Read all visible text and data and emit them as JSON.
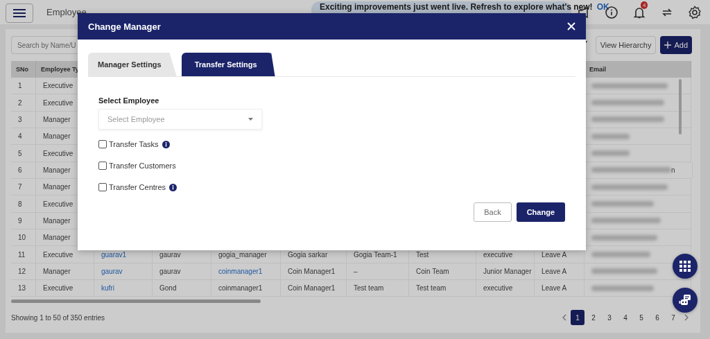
{
  "top_bar": {
    "title": "Employee",
    "banner": {
      "text": "Exciting improvements just went live. Refresh to explore what's new!",
      "action": "OK"
    },
    "notification_count": "4"
  },
  "toolbar": {
    "search": {
      "placeholder": "Search by Name/U"
    },
    "buttons": [
      {
        "label": "View Hierarchy",
        "kind": "outline"
      },
      {
        "label": "Add",
        "kind": "primary"
      }
    ]
  },
  "table": {
    "columns": [
      "SNo",
      "Employee Ty",
      "Email"
    ],
    "rows": [
      {
        "cells": [
          {
            "text": "1"
          },
          {
            "text": "Executive"
          }
        ]
      },
      {
        "cells": [
          {
            "text": "2"
          },
          {
            "text": "Executive"
          }
        ]
      },
      {
        "cells": [
          {
            "text": "3"
          },
          {
            "text": "Manager"
          }
        ]
      },
      {
        "cells": [
          {
            "text": "4"
          },
          {
            "text": "Manager"
          }
        ]
      },
      {
        "cells": [
          {
            "text": "5"
          },
          {
            "text": "Executive"
          }
        ]
      },
      {
        "cells": [
          {
            "text": "6"
          },
          {
            "text": "Manager"
          }
        ],
        "email_tail": "n"
      },
      {
        "cells": [
          {
            "text": "7"
          },
          {
            "text": "Manager"
          }
        ]
      },
      {
        "cells": [
          {
            "text": "8"
          },
          {
            "text": "Executive"
          }
        ]
      },
      {
        "cells": [
          {
            "text": "9"
          },
          {
            "text": "Manager"
          }
        ]
      },
      {
        "cells": [
          {
            "text": "10"
          },
          {
            "text": "Manager"
          }
        ]
      },
      {
        "cells": [
          {
            "text": "11"
          },
          {
            "text": "Executive"
          },
          {
            "text": "guarav1",
            "link": true
          },
          {
            "text": "gaurav"
          },
          {
            "text": "gogia_manager"
          },
          {
            "text": "Gogia sarkar"
          },
          {
            "text": "Gogia Team-1"
          },
          {
            "text": "Test"
          },
          {
            "text": "executive"
          },
          {
            "text": "Leave A"
          }
        ]
      },
      {
        "cells": [
          {
            "text": "12"
          },
          {
            "text": "Manager"
          },
          {
            "text": "gaurav",
            "link": true
          },
          {
            "text": "gaurav"
          },
          {
            "text": "coinmanager1",
            "link": true
          },
          {
            "text": "Coin Manager1"
          },
          {
            "text": "–"
          },
          {
            "text": "Coin Team"
          },
          {
            "text": "Junior Manager"
          },
          {
            "text": "Leave A"
          }
        ]
      },
      {
        "cells": [
          {
            "text": "13"
          },
          {
            "text": "Executive"
          },
          {
            "text": "kufri",
            "link": true
          },
          {
            "text": "Gond"
          },
          {
            "text": "coinmanager1"
          },
          {
            "text": "Coin Manager1"
          },
          {
            "text": "Test team"
          },
          {
            "text": "Test team"
          },
          {
            "text": "executive"
          },
          {
            "text": "Leave A"
          }
        ]
      }
    ]
  },
  "footer": {
    "summary": "Showing 1 to 50 of 350 entries",
    "pages": [
      {
        "label": "1",
        "selected": true
      },
      {
        "label": "2",
        "selected": false
      },
      {
        "label": "3",
        "selected": false
      },
      {
        "label": "4",
        "selected": false
      },
      {
        "label": "5",
        "selected": false
      },
      {
        "label": "6",
        "selected": false
      },
      {
        "label": "7",
        "selected": false
      }
    ]
  },
  "dialog": {
    "title": "Change Manager",
    "tabs": [
      {
        "label": "Manager Settings",
        "selected": false
      },
      {
        "label": "Transfer Settings",
        "selected": true
      }
    ],
    "field": {
      "label": "Select Employee",
      "placeholder": "Select Employee"
    },
    "options": [
      {
        "label": "Transfer Tasks",
        "checked": false,
        "info": true
      },
      {
        "label": "Transfer Customers",
        "checked": false,
        "info": false
      },
      {
        "label": "Transfer Centres",
        "checked": false,
        "info": true
      }
    ],
    "buttons": [
      {
        "label": "Back",
        "kind": "secondary"
      },
      {
        "label": "Change",
        "kind": "primary"
      }
    ]
  }
}
